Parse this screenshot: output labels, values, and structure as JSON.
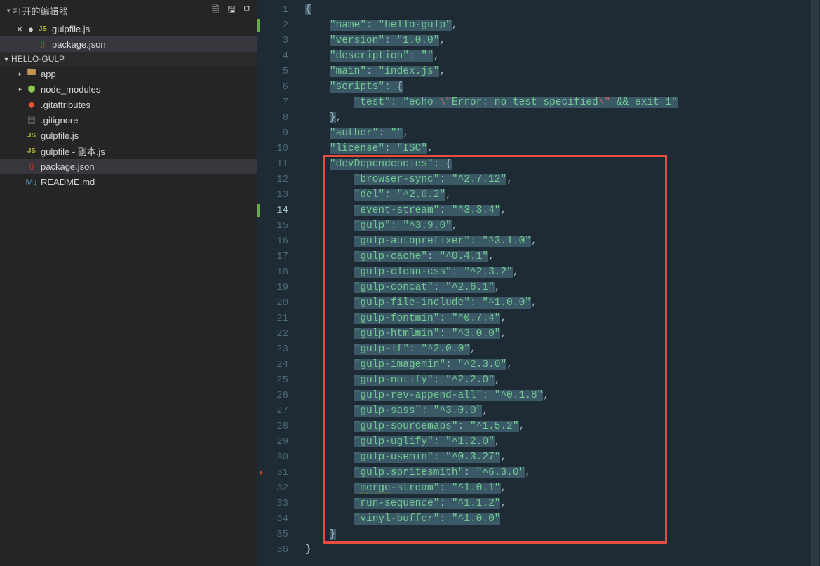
{
  "sidebar": {
    "open_editors_label": "打开的编辑器",
    "open_editors": [
      {
        "name": "gulpfile.js",
        "icon": "js",
        "dirty": true,
        "active": false,
        "close": true
      },
      {
        "name": "package.json",
        "icon": "json",
        "dirty": false,
        "active": true,
        "close": false
      }
    ],
    "project_label": "HELLO-GULP",
    "tree": [
      {
        "name": "app",
        "icon": "folder",
        "twisty": "▸"
      },
      {
        "name": "node_modules",
        "icon": "node",
        "twisty": "▸"
      },
      {
        "name": ".gitattributes",
        "icon": "git",
        "twisty": ""
      },
      {
        "name": ".gitignore",
        "icon": "gitign",
        "twisty": ""
      },
      {
        "name": "gulpfile.js",
        "icon": "js",
        "twisty": ""
      },
      {
        "name": "gulpfile - 副本.js",
        "icon": "js",
        "twisty": ""
      },
      {
        "name": "package.json",
        "icon": "json",
        "twisty": "",
        "active": true
      },
      {
        "name": "README.md",
        "icon": "md",
        "twisty": ""
      }
    ]
  },
  "editor": {
    "line_count": 36,
    "current_line": 14,
    "marked_lines": [
      2,
      14
    ],
    "breakpoint_lines": [
      31
    ],
    "redbox": {
      "top_line": 11,
      "bottom_line": 35
    }
  },
  "file": {
    "name": "hello-gulp",
    "version": "1.0.0",
    "description": "",
    "main": "index.js",
    "scripts_test": "echo \\\"Error: no test specified\\\" && exit 1",
    "author": "",
    "license": "ISC",
    "devDependencies": {
      "browser-sync": "^2.7.12",
      "del": "^2.0.2",
      "event-stream": "^3.3.4",
      "gulp": "^3.9.0",
      "gulp-autoprefixer": "^3.1.0",
      "gulp-cache": "^0.4.1",
      "gulp-clean-css": "^2.3.2",
      "gulp-concat": "^2.6.1",
      "gulp-file-include": "^1.0.0",
      "gulp-fontmin": "^0.7.4",
      "gulp-htmlmin": "^3.0.0",
      "gulp-if": "^2.0.0",
      "gulp-imagemin": "^2.3.0",
      "gulp-notify": "^2.2.0",
      "gulp-rev-append-all": "^0.1.8",
      "gulp-sass": "^3.0.0",
      "gulp-sourcemaps": "^1.5.2",
      "gulp-uglify": "^1.2.0",
      "gulp-usemin": "^0.3.27",
      "gulp.spritesmith": "^6.3.0",
      "merge-stream": "^1.0.1",
      "run-sequence": "^1.1.2",
      "vinyl-buffer": "^1.0.0"
    }
  }
}
